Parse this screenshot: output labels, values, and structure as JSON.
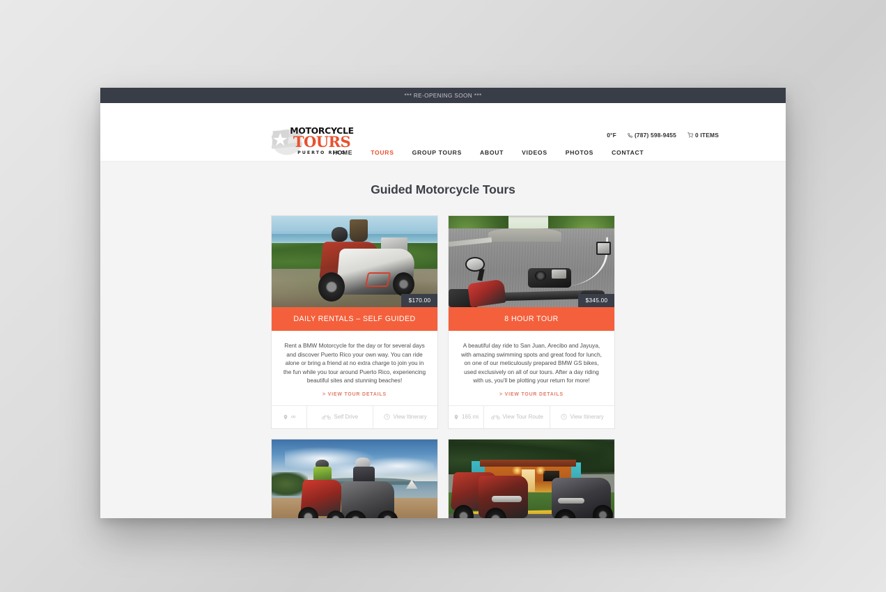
{
  "announcement": {
    "text": "*** RE-OPENING SOON ***"
  },
  "logo": {
    "line1": "MOTORCYCLE",
    "line2": "TOURS",
    "line3": "PUERTO RICO",
    "accent_color": "#e8512e"
  },
  "utility": {
    "temperature": "0°F",
    "phone": "(787) 598-9455",
    "cart": "0 ITEMS"
  },
  "nav": {
    "items": [
      {
        "label": "HOME",
        "active": false
      },
      {
        "label": "TOURS",
        "active": true
      },
      {
        "label": "GROUP TOURS",
        "active": false
      },
      {
        "label": "ABOUT",
        "active": false
      },
      {
        "label": "VIDEOS",
        "active": false
      },
      {
        "label": "PHOTOS",
        "active": false
      },
      {
        "label": "CONTACT",
        "active": false
      }
    ]
  },
  "page": {
    "title": "Guided Motorcycle Tours",
    "title_color": "#3c3f46",
    "background": "#f4f4f4"
  },
  "cards": [
    {
      "price": "$170.00",
      "title": "DAILY RENTALS – SELF GUIDED",
      "description": "Rent a BMW Motorcycle for the day or for several days and discover Puerto Rico your own way. You can ride alone or bring a friend at no extra charge to join you in the fun while you tour around Puerto Rico, experiencing beautiful sites and stunning beaches!",
      "link": "> VIEW TOUR DETAILS",
      "distance": "∞",
      "drive": "Self Drive",
      "itinerary": "View Itinerary",
      "image_alt": "motorcycles parked on a coastal dirt path by the ocean"
    },
    {
      "price": "$345.00",
      "title": "8 HOUR TOUR",
      "description": "A beautiful day ride to San Juan, Arecibo and Jayuya, with amazing swimming spots and great food for lunch, on one of our meticulously prepared BMW GS bikes, used exclusively on all of our tours. After a day riding with us, you'll be plotting your return for more!",
      "link": "> VIEW TOUR DETAILS",
      "distance": "165 mi",
      "drive": "View Tour Route",
      "itinerary": "View Itinerary",
      "image_alt": "rider point-of-view over handlebars on a curving forest road"
    },
    {
      "image_alt": "two riders on adventure bikes beside a bay with dramatic clouds"
    },
    {
      "image_alt": "motorcycles parked at dusk outside a brightly painted house"
    }
  ],
  "theme": {
    "orange": "#f4603c",
    "dark": "#393d48",
    "link": "#e27a63",
    "muted": "#c2c2c2"
  }
}
